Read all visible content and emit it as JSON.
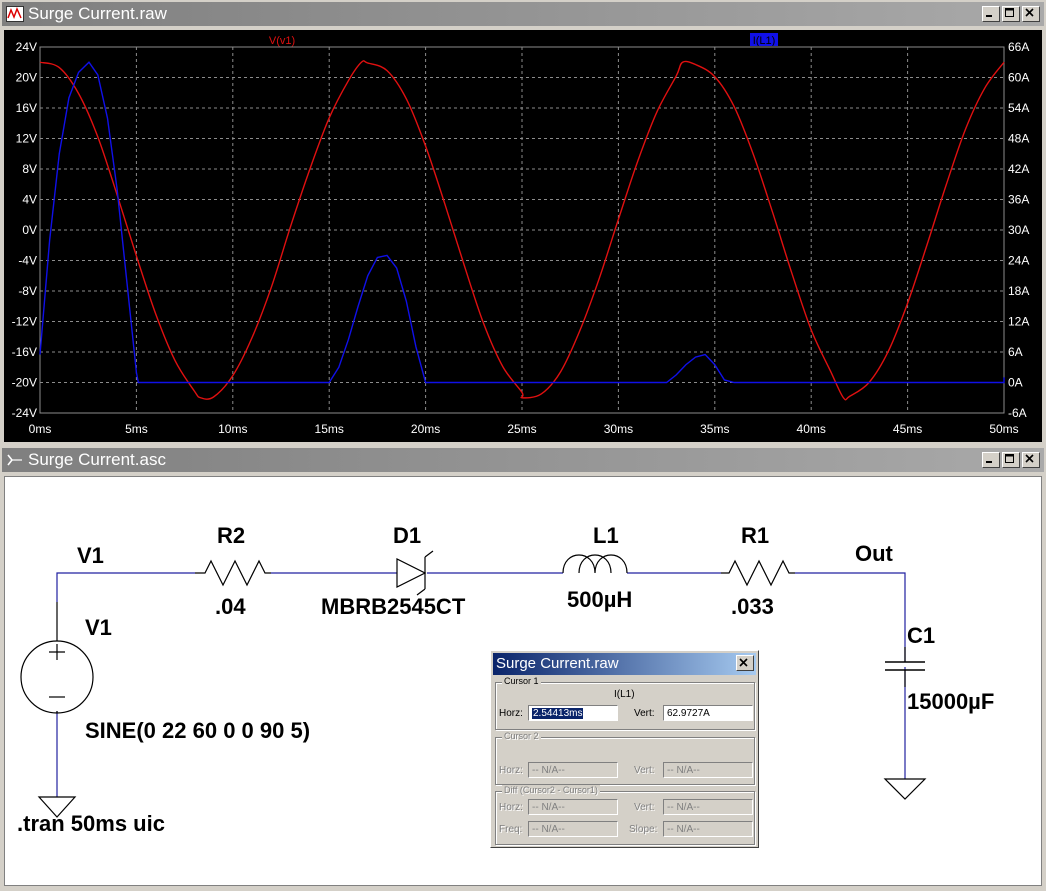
{
  "plot_window": {
    "title": "Surge Current.raw",
    "trace_labels": {
      "v": "V(v1)",
      "i": "I(L1)"
    },
    "colors": {
      "v": "#e01010",
      "i": "#1010e8",
      "bg": "#000000",
      "grid": "#8c8c8c",
      "axis_text": "#ffffff"
    }
  },
  "chart_data": {
    "type": "line",
    "x": {
      "unit": "ms",
      "range": [
        0,
        50
      ],
      "ticks": [
        "0ms",
        "5ms",
        "10ms",
        "15ms",
        "20ms",
        "25ms",
        "30ms",
        "35ms",
        "40ms",
        "45ms",
        "50ms"
      ]
    },
    "y_left": {
      "unit": "V",
      "range": [
        -24,
        24
      ],
      "ticks": [
        "24V",
        "20V",
        "16V",
        "12V",
        "8V",
        "4V",
        "0V",
        "-4V",
        "-8V",
        "-12V",
        "-16V",
        "-20V",
        "-24V"
      ]
    },
    "y_right": {
      "unit": "A",
      "range": [
        -6,
        66
      ],
      "ticks": [
        "66A",
        "60A",
        "54A",
        "48A",
        "42A",
        "36A",
        "30A",
        "24A",
        "18A",
        "12A",
        "6A",
        "0A",
        "-6A"
      ]
    },
    "grid": true,
    "series": [
      {
        "name": "V(v1)",
        "axis": "left",
        "points": [
          [
            0,
            22
          ],
          [
            1,
            21.3
          ],
          [
            2,
            17.9
          ],
          [
            3,
            12.2
          ],
          [
            4,
            4.6
          ],
          [
            5,
            -3.4
          ],
          [
            6,
            -11.0
          ],
          [
            7,
            -17.1
          ],
          [
            8,
            -21.1
          ],
          [
            8.33,
            -22
          ],
          [
            9,
            -21.9
          ],
          [
            10,
            -19.1
          ],
          [
            11,
            -14.1
          ],
          [
            12,
            -7.5
          ],
          [
            13,
            0.5
          ],
          [
            14,
            8.0
          ],
          [
            15,
            14.7
          ],
          [
            16,
            19.6
          ],
          [
            16.67,
            22
          ],
          [
            17,
            21.9
          ],
          [
            18,
            20.9
          ],
          [
            19,
            17.2
          ],
          [
            20,
            11.0
          ],
          [
            21,
            3.4
          ],
          [
            22,
            -4.6
          ],
          [
            23,
            -12.2
          ],
          [
            24,
            -17.9
          ],
          [
            25,
            -21.3
          ],
          [
            25,
            -22
          ],
          [
            26,
            -21.5
          ],
          [
            27,
            -18.6
          ],
          [
            28,
            -13.2
          ],
          [
            29,
            -6.4
          ],
          [
            30,
            1.4
          ],
          [
            31,
            9.0
          ],
          [
            32,
            15.5
          ],
          [
            33,
            20.2
          ],
          [
            33.33,
            22
          ],
          [
            34,
            21.7
          ],
          [
            35,
            20.1
          ],
          [
            36,
            16.2
          ],
          [
            37,
            9.9
          ],
          [
            38,
            2.3
          ],
          [
            39,
            -5.7
          ],
          [
            40,
            -13.1
          ],
          [
            41,
            -18.5
          ],
          [
            41.67,
            -22
          ],
          [
            42,
            -21.8
          ],
          [
            43,
            -20.0
          ],
          [
            44,
            -15.9
          ],
          [
            45,
            -9.6
          ],
          [
            46,
            -2.0
          ],
          [
            47,
            5.9
          ],
          [
            48,
            13.2
          ],
          [
            49,
            18.6
          ],
          [
            50,
            22
          ]
        ]
      },
      {
        "name": "I(L1)",
        "axis": "right",
        "points": [
          [
            0,
            5.5
          ],
          [
            0.5,
            28
          ],
          [
            1,
            45
          ],
          [
            1.5,
            56
          ],
          [
            2,
            61
          ],
          [
            2.54,
            63
          ],
          [
            3,
            60.5
          ],
          [
            3.5,
            52
          ],
          [
            4,
            38
          ],
          [
            4.5,
            20
          ],
          [
            5,
            2
          ],
          [
            5.1,
            0
          ],
          [
            6,
            0
          ],
          [
            15,
            0
          ],
          [
            15.5,
            3
          ],
          [
            16,
            8.5
          ],
          [
            16.5,
            15
          ],
          [
            17,
            21
          ],
          [
            17.5,
            24.6
          ],
          [
            18,
            25
          ],
          [
            18.5,
            22.5
          ],
          [
            19,
            16
          ],
          [
            19.5,
            7
          ],
          [
            20,
            0
          ],
          [
            20.2,
            0
          ],
          [
            32.5,
            0
          ],
          [
            33,
            1.5
          ],
          [
            33.5,
            3.5
          ],
          [
            34,
            5
          ],
          [
            34.5,
            5.5
          ],
          [
            35,
            3.5
          ],
          [
            35.5,
            0.5
          ],
          [
            36,
            0
          ],
          [
            50,
            0
          ],
          [
            50,
            1
          ]
        ]
      }
    ]
  },
  "schematic_window": {
    "title": "Surge Current.asc",
    "labels": {
      "net_v1": "V1",
      "v1_name": "V1",
      "v1_value": "SINE(0 22 60 0 0 90 5)",
      "tran": ".tran 50ms  uic",
      "r2_name": "R2",
      "r2_value": ".04",
      "d1_name": "D1",
      "d1_value": "MBRB2545CT",
      "l1_name": "L1",
      "l1_value": "500µH",
      "r1_name": "R1",
      "r1_value": ".033",
      "net_out": "Out",
      "c1_name": "C1",
      "c1_value": "15000µF"
    }
  },
  "cursor_dialog": {
    "title": "Surge Current.raw",
    "cursor1": {
      "label": "Cursor 1",
      "trace": "I(L1)",
      "horz_label": "Horz:",
      "horz": "2.54413ms",
      "vert_label": "Vert:",
      "vert": "62.9727A"
    },
    "cursor2": {
      "label": "Cursor 2",
      "horz_label": "Horz:",
      "horz": "-- N/A--",
      "vert_label": "Vert:",
      "vert": "-- N/A--"
    },
    "diff": {
      "label": "Diff (Cursor2 - Cursor1)",
      "horz_label": "Horz:",
      "horz": "-- N/A--",
      "vert_label": "Vert:",
      "vert": "-- N/A--",
      "freq_label": "Freq:",
      "freq": "-- N/A--",
      "slope_label": "Slope:",
      "slope": "-- N/A--"
    }
  }
}
